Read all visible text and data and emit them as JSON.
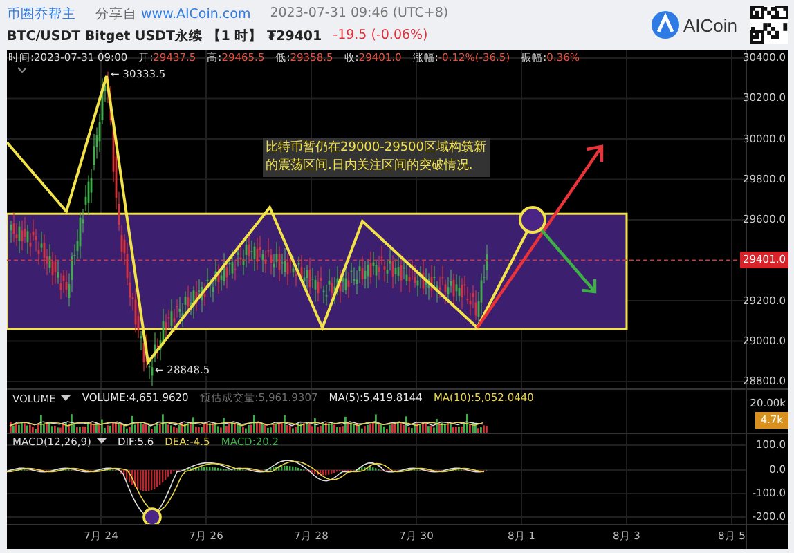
{
  "header": {
    "author": "币圈乔帮主",
    "share_prefix": "分享自",
    "share_url": "www.AICoin.com",
    "timestamp": "2023-07-31 09:46 (UTC+8)",
    "symbol": "BTC/USDT Bitget USDT永续 【1 时】 ₮29401",
    "change": "-19.5 (-0.06%)",
    "logo_text": "AICoin"
  },
  "ohlc_bar": [
    {
      "label": "时间:",
      "value": "2023-07-31 09:00",
      "kind": "plain"
    },
    {
      "label": "开:",
      "value": "29437.5",
      "kind": "price"
    },
    {
      "label": "高:",
      "value": "29465.5",
      "kind": "price"
    },
    {
      "label": "低:",
      "value": "29358.5",
      "kind": "price"
    },
    {
      "label": "收:",
      "value": "29401.0",
      "kind": "price"
    },
    {
      "label": "涨幅:",
      "value": "-0.12%(-36.5)",
      "kind": "price"
    },
    {
      "label": "振幅:",
      "value": "0.36%",
      "kind": "price"
    }
  ],
  "price_pane": {
    "axis_ticks": [
      "30400.0",
      "30200.0",
      "30000.0",
      "29800.0",
      "29600.0",
      "29200.0",
      "29000.0",
      "28800.0"
    ],
    "last_price": "29401.0",
    "high_marker": "← 30333.5",
    "low_marker": "← 28848.5",
    "annotation": "比特币暂仍在29000-29500区域构筑新的震荡区间.日内关注区间的突破情况."
  },
  "volume_pane": {
    "indicator": "VOLUME",
    "legend": [
      {
        "text": "VOLUME:4,651.9620",
        "color": "#e6e6e6"
      },
      {
        "text": "预估成交量:5,961.9307",
        "color": "#6b6b6b"
      },
      {
        "text": "MA(5):5,419.8144",
        "color": "#e6e6e6"
      },
      {
        "text": "MA(10):5,052.0440",
        "color": "#e8d44a"
      }
    ],
    "axis_tick": "20.00k",
    "last_value": "4.7k"
  },
  "macd_pane": {
    "indicator": "MACD(12,26,9)",
    "legend": [
      {
        "text": "DIF:5.6",
        "color": "#e6e6e6"
      },
      {
        "text": "DEA:-4.5",
        "color": "#e8d44a"
      },
      {
        "text": "MACD:20.2",
        "color": "#3fae49"
      }
    ],
    "axis_ticks": [
      "100.0",
      "0.0",
      "-100.0",
      "-200.0"
    ]
  },
  "x_axis": [
    "7月 24",
    "7月 26",
    "7月 28",
    "7月 30",
    "8月 1",
    "8月 3",
    "8月 5"
  ]
}
